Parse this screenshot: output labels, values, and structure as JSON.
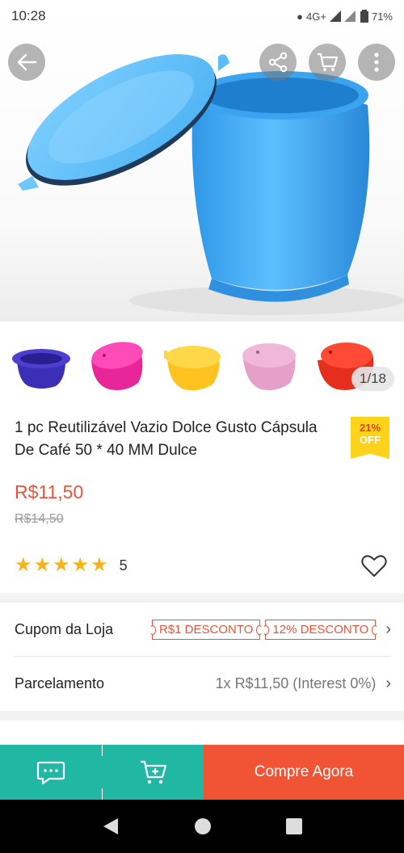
{
  "status_bar": {
    "time": "10:28",
    "network": "4G+",
    "battery": "71%"
  },
  "gallery": {
    "counter": "1/18"
  },
  "product": {
    "title": "1 pc Reutilizável Vazio Dolce Gusto Cápsula De Café 50 * 40 MM Dulce",
    "discount_pct": "21%",
    "discount_off": "OFF",
    "price": "R$11,50",
    "old_price": "R$14,50",
    "rating_value": 5,
    "rating_count": "5"
  },
  "coupon_row": {
    "label": "Cupom da Loja",
    "coupon1": "R$1 DESCONTO",
    "coupon2": "12% DESCONTO"
  },
  "installment_row": {
    "label": "Parcelamento",
    "value": "1x R$11,50 (Interest 0%)"
  },
  "bottom_bar": {
    "buy_label": "Compre Agora"
  },
  "colors": {
    "teal": "#21b8a3",
    "orange": "#f05434",
    "price": "#e8543b",
    "star": "#f7b416",
    "badge": "#ffd31a"
  },
  "thumbnails": [
    {
      "color": "#3b2fb8"
    },
    {
      "color": "#e8269a"
    },
    {
      "color": "#ffc21f"
    },
    {
      "color": "#e4a0c8"
    },
    {
      "color": "#e52e1e"
    }
  ]
}
